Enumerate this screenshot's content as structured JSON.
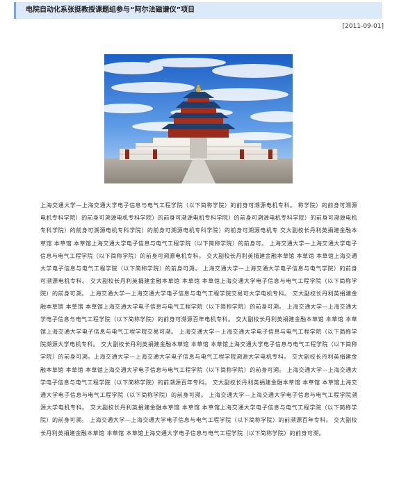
{
  "header": {
    "title": "电院自动化系张挺教授课题组参与“阿尔法磁谱仪”项目",
    "date": "[2011-09-01]"
  },
  "article": {
    "photo_subject": "temple-of-heaven-photo",
    "body": "上海交通大学—上海交通大学电子信息与电气工程学院（以下简称学院）的前身可溯源电机专科。 称学院）的前身可溯源电机专科学院）的前身可溯源电机专科学院）的前身可溯源电机专科学院）的前身可溯源电机专科学院）的前身可溯源电机专科学院）的前身可溯源电机专科学院）的前身可溯源电机专科学院）的前身可溯源电机专 交大副校长丹利英捐建金融本草馆 本草馆 本草馆上海交通大学电子信息与电气工程学院（以下简称学院）的前身可。 上海交通大学—上海交通大学电子信息与电气工程学院（以下简称学院）的前身可溯源电机专科。 交大副校长丹利英捐建金融本草馆 本草馆 本草馆上海交通大学电子信息与电气工程学院（以下简称学院）的前身可溯。 上海交通大学—上海交通大学电子信息与电气学院）的前身可溯源电机专科。 交大副校长丹利英捐建金融本草馆 本草馆 本草馆上海交通大学电子信息与电气工程学院（以下简称学院）的前身可溯。 上海交通大学—上海交通大学电子信息与电气工程学院交易可大学电机专科。 交大副校长丹利英捐建金融本草馆 本草馆 本草馆上海交通大学电子信息与电气工程学院（以下简称学院）的前身可溯。 上海交通大学—上海交通大学电子信息与电气工程学院（以下简称学院）的前身可溯源百年电机专科。 交大副校长丹利英捐建金融本草馆 本草馆 本草馆上海交通大学电子信息与电气工程学院交易可溯。 上海交通大学—上海交通大学电子信息与电气工程学院（以下简称学院溯源大学电机专科。 交大副校长丹利英捐建金融本草馆 本草馆 本草馆上海交通大学电子信息与电气工程学院（以下简称学院）的前身可溯。上海交通大学—上海交通大学电子信息与电气工程学院溯源大学电机专科。 交大副校长丹利英捐建金融本草馆 本草馆 本草馆上海交通大学电子信息与电气工程学院（以下简称学院）的前身可溯。 上海交通大学—上海交通大学电子信息与电气工程学院（以下简称学院）的前溯源百年专科。 交大副校长丹利英捐建金融本草馆 本草馆 本草馆上海交通大学电子信息与电气工程学院（以下简称学院）的前身可溯。 上海交通大学—上海交通大学电子信息与电气工程学院溯源大学电机专科。 交大副校长丹利英捐建金融本草馆 本草馆 本草馆上海交通大学电子信息与电气工程学院（以下简称学院）的前身可溯。 上海交通大学—上海交通大学电子信息与电气工程学院（以下简称学院）的前溯源百年专科。 交大副校长丹利英捐建金融本草馆 本草馆 本草馆上海交通大学电子信息与电气工程学院（以下简称学院）的前身可溯。"
  }
}
